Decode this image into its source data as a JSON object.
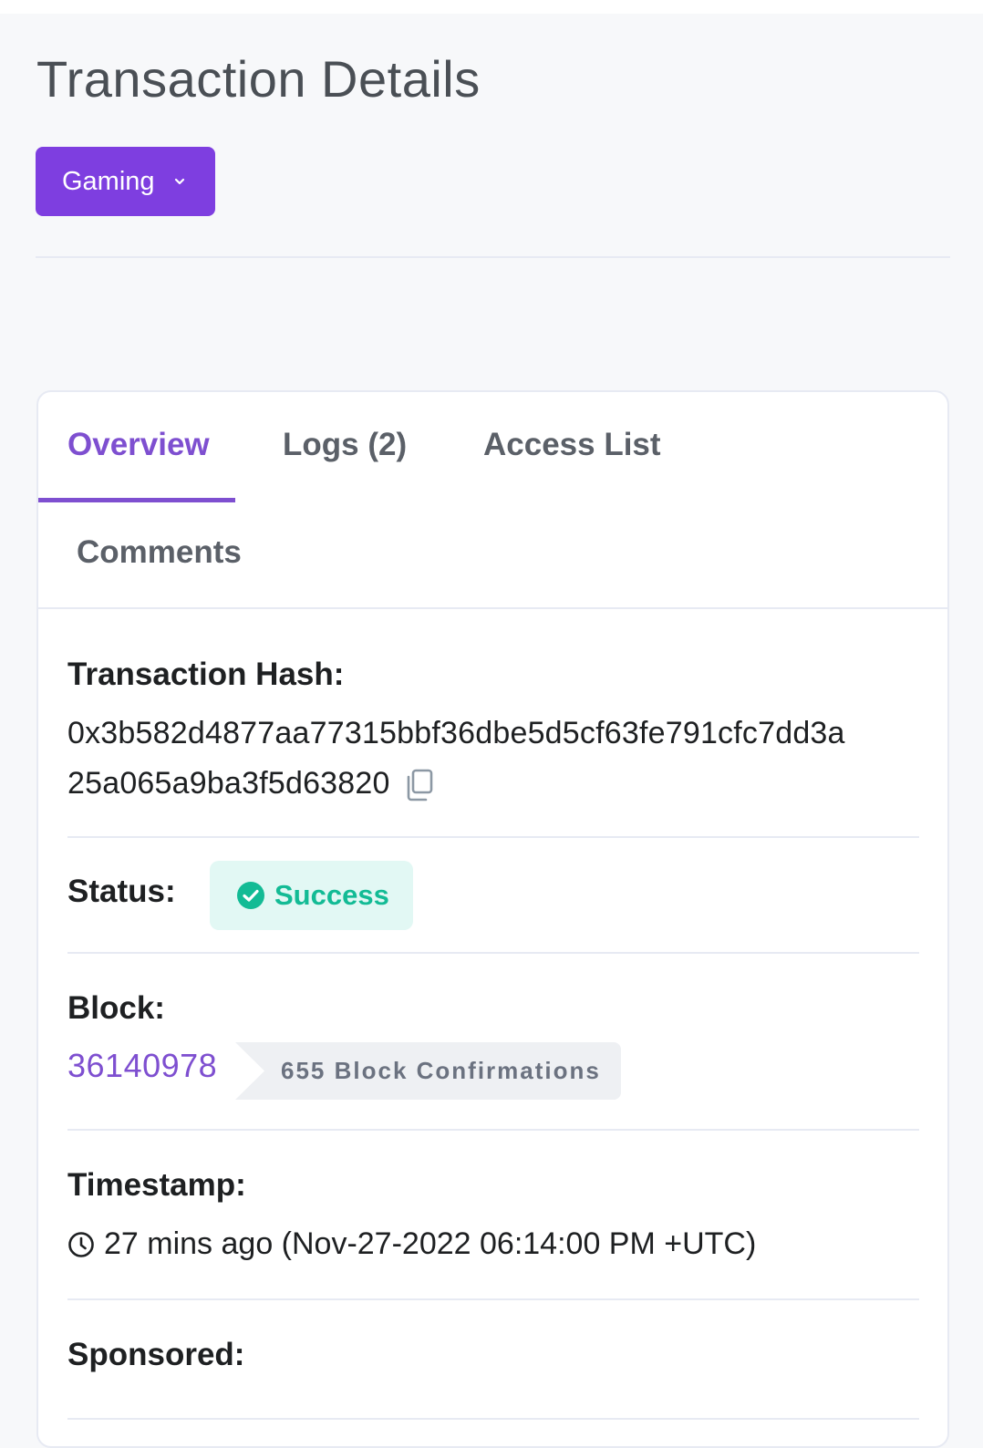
{
  "page": {
    "title": "Transaction Details"
  },
  "category_dropdown": {
    "label": "Gaming",
    "icon": "chevron-down-icon",
    "color": "#7e3ee0"
  },
  "tabs": [
    {
      "label": "Overview",
      "active": true
    },
    {
      "label": "Logs (2)",
      "active": false
    },
    {
      "label": "Access List",
      "active": false
    },
    {
      "label": "Comments",
      "active": false
    }
  ],
  "details": {
    "hash": {
      "label": "Transaction Hash:",
      "value_line1": "0x3b582d4877aa77315bbf36dbe5d5cf63fe791cfc7dd3a",
      "value_line2": "25a065a9ba3f5d63820",
      "copy_icon": "copy-icon"
    },
    "status": {
      "label": "Status:",
      "value": "Success",
      "icon": "check-circle-icon",
      "color": "#13bb95"
    },
    "block": {
      "label": "Block:",
      "number": "36140978",
      "confirmations": "655 Block Confirmations"
    },
    "timestamp": {
      "label": "Timestamp:",
      "value": "27 mins ago (Nov-27-2022 06:14:00 PM +UTC)",
      "icon": "clock-icon"
    },
    "sponsored": {
      "label": "Sponsored:"
    }
  },
  "colors": {
    "accent": "#7e4fd0",
    "background": "#f7f8fa",
    "divider": "#e7eaf3"
  }
}
